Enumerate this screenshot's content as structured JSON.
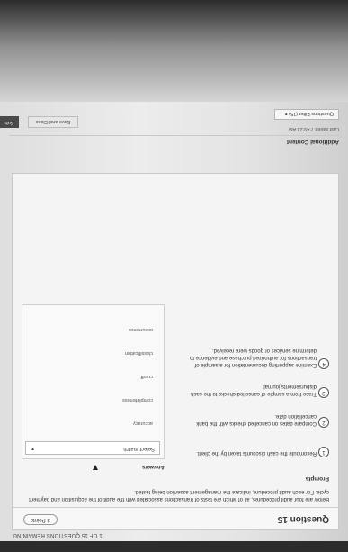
{
  "header": {
    "remaining": "1 OF 15 QUESTIONS REMAINING"
  },
  "question": {
    "title": "Question 15",
    "points": "2 Points",
    "instructions": "Below are four audit procedures, all of which are tests of transactions associated with the audit of the acquisition and payment cycle. For each audit procedure, indicate the management assertion being tested.",
    "prompts_heading": "Prompts",
    "answers_heading": "Answers",
    "prompts": [
      {
        "num": "1",
        "text": "Recompute the cash discounts taken by the client."
      },
      {
        "num": "2",
        "text": "Compare dates on cancelled checks with the bank cancellation date."
      },
      {
        "num": "3",
        "text": "Trace from a sample of cancelled checks to the cash disbursements journal."
      },
      {
        "num": "4",
        "text": "Examine supporting documentation for a sample of transactions for authorized purchase and evidence to determine services or goods were received."
      }
    ],
    "select": {
      "label": "Select match"
    },
    "options": [
      "accuracy",
      "completeness",
      "cutoff",
      "classification",
      "occurrence"
    ]
  },
  "footer": {
    "additional_content": "Additional Content",
    "last_saved": "Last saved 7:49:23 AM",
    "filter_label": "Questions Filter (15)",
    "save_close": "Save and Close",
    "submit": "Sub"
  }
}
